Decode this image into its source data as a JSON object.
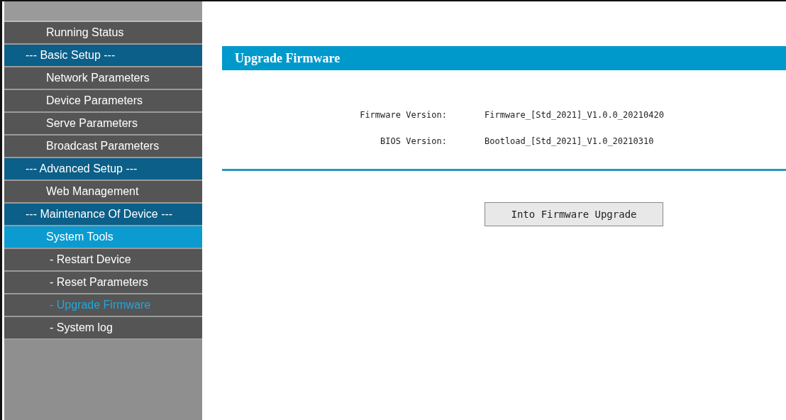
{
  "sidebar": {
    "items": [
      {
        "label": "Running Status",
        "kind": "link",
        "selected": false
      },
      {
        "label": "--- Basic Setup ---",
        "kind": "section"
      },
      {
        "label": "Network Parameters",
        "kind": "link",
        "selected": false
      },
      {
        "label": "Device Parameters",
        "kind": "link",
        "selected": false
      },
      {
        "label": "Serve Parameters",
        "kind": "link",
        "selected": false
      },
      {
        "label": "Broadcast Parameters",
        "kind": "link",
        "selected": false
      },
      {
        "label": "--- Advanced Setup ---",
        "kind": "section"
      },
      {
        "label": "Web Management",
        "kind": "link",
        "selected": false
      },
      {
        "label": "--- Maintenance Of Device ---",
        "kind": "section"
      },
      {
        "label": "System Tools",
        "kind": "link",
        "selected": true
      },
      {
        "label": "- Restart Device",
        "kind": "sublink",
        "selected": false
      },
      {
        "label": "- Reset Parameters",
        "kind": "sublink",
        "selected": false
      },
      {
        "label": "- Upgrade Firmware",
        "kind": "sublink",
        "selected": true
      },
      {
        "label": "- System log",
        "kind": "sublink",
        "selected": false
      }
    ]
  },
  "main": {
    "title": "Upgrade Firmware",
    "fields": [
      {
        "label": "Firmware Version:",
        "value": "Firmware_[Std_2021]_V1.0.0_20210420"
      },
      {
        "label": "BIOS Version:",
        "value": "Bootload_[Std_2021]_V1.0_20210310"
      }
    ],
    "button": "Into Firmware Upgrade"
  }
}
